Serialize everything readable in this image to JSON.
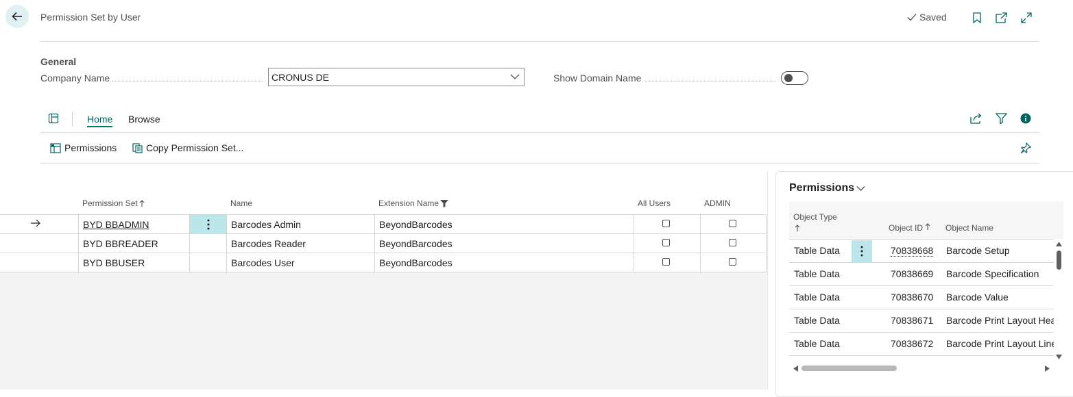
{
  "header": {
    "title": "Permission Set by User",
    "saved_label": "Saved"
  },
  "general": {
    "section_title": "General",
    "company_label": "Company Name",
    "company_value": "CRONUS DE",
    "domain_label": "Show Domain Name",
    "show_domain": false
  },
  "tabs": [
    {
      "label": "Home",
      "active": true
    },
    {
      "label": "Browse",
      "active": false
    }
  ],
  "actions": {
    "permissions": "Permissions",
    "copy": "Copy Permission Set..."
  },
  "grid": {
    "columns": [
      "Permission Set",
      "Name",
      "Extension Name",
      "All Users",
      "ADMIN"
    ],
    "rows": [
      {
        "set": "BYD BBADMIN",
        "name": "Barcodes Admin",
        "extension": "BeyondBarcodes",
        "all_users": false,
        "admin": false,
        "selected": true
      },
      {
        "set": "BYD BBREADER",
        "name": "Barcodes Reader",
        "extension": "BeyondBarcodes",
        "all_users": false,
        "admin": false,
        "selected": false
      },
      {
        "set": "BYD BBUSER",
        "name": "Barcodes User",
        "extension": "BeyondBarcodes",
        "all_users": false,
        "admin": false,
        "selected": false
      }
    ]
  },
  "panel": {
    "title": "Permissions",
    "columns": {
      "object_type": "Object Type",
      "object_id": "Object ID",
      "object_name": "Object Name"
    },
    "rows": [
      {
        "type": "Table Data",
        "id": "70838668",
        "name": "Barcode Setup"
      },
      {
        "type": "Table Data",
        "id": "70838669",
        "name": "Barcode Specification"
      },
      {
        "type": "Table Data",
        "id": "70838670",
        "name": "Barcode Value"
      },
      {
        "type": "Table Data",
        "id": "70838671",
        "name": "Barcode Print Layout Hea"
      },
      {
        "type": "Table Data",
        "id": "70838672",
        "name": "Barcode Print Layout Line"
      }
    ]
  },
  "colors": {
    "accent": "#00796b",
    "selection": "#bde6ea",
    "back_bg": "#dff1f3"
  }
}
